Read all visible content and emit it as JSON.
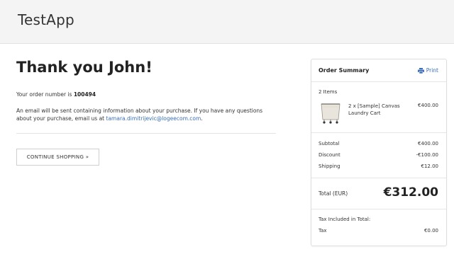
{
  "header": {
    "brand": "TestApp"
  },
  "confirmation": {
    "title": "Thank you John!",
    "order_prefix": "Your order number is ",
    "order_number": "100494",
    "info_text": "An email will be sent containing information about your purchase. If you have any questions about your purchase, email us at ",
    "email": "tamara.dimitrijevic@logeecom.com",
    "info_suffix": ".",
    "continue_label": "CONTINUE SHOPPING »"
  },
  "summary": {
    "title": "Order Summary",
    "print_label": "Print",
    "print_icon": "printer-icon",
    "items_count": "2 Items",
    "item": {
      "name": "2 x [Sample] Canvas Laundry Cart",
      "price": "€400.00",
      "thumb_icon": "laundry-cart-image"
    },
    "subtotal_label": "Subtotal",
    "subtotal_value": "€400.00",
    "discount_label": "Discount",
    "discount_value": "-€100.00",
    "shipping_label": "Shipping",
    "shipping_value": "€12.00",
    "total_label": "Total (EUR)",
    "total_value": "€312.00",
    "tax_included_label": "Tax Included in Total:",
    "tax_label": "Tax",
    "tax_value": "€0.00"
  },
  "colors": {
    "link": "#3b6fb6",
    "header_bg": "#f4f4f4"
  }
}
